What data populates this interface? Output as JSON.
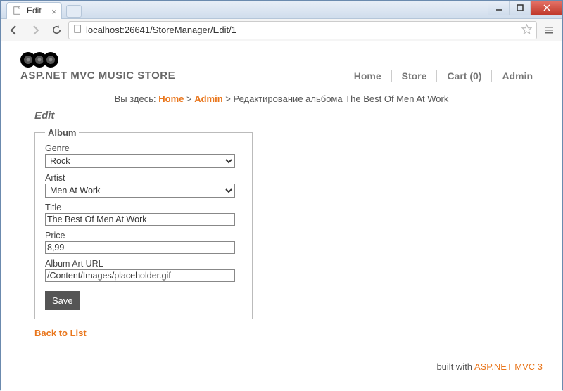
{
  "browser": {
    "tab_title": "Edit",
    "url_display": "localhost:26641/StoreManager/Edit/1"
  },
  "site": {
    "title": "ASP.NET MVC MUSIC STORE"
  },
  "nav": {
    "home": "Home",
    "store": "Store",
    "cart": "Cart (0)",
    "admin": "Admin"
  },
  "breadcrumb": {
    "prefix": "Вы здесь: ",
    "home": "Home",
    "admin": "Admin",
    "current": "Редактирование альбома The Best Of Men At Work"
  },
  "page_heading": "Edit",
  "form": {
    "legend": "Album",
    "genre_label": "Genre",
    "genre_value": "Rock",
    "artist_label": "Artist",
    "artist_value": "Men At Work",
    "title_label": "Title",
    "title_value": "The Best Of Men At Work",
    "price_label": "Price",
    "price_value": "8,99",
    "arturl_label": "Album Art URL",
    "arturl_value": "/Content/Images/placeholder.gif",
    "save_label": "Save"
  },
  "back_link": "Back to List",
  "footer": {
    "built_with": "built with ",
    "framework": "ASP.NET MVC 3"
  }
}
